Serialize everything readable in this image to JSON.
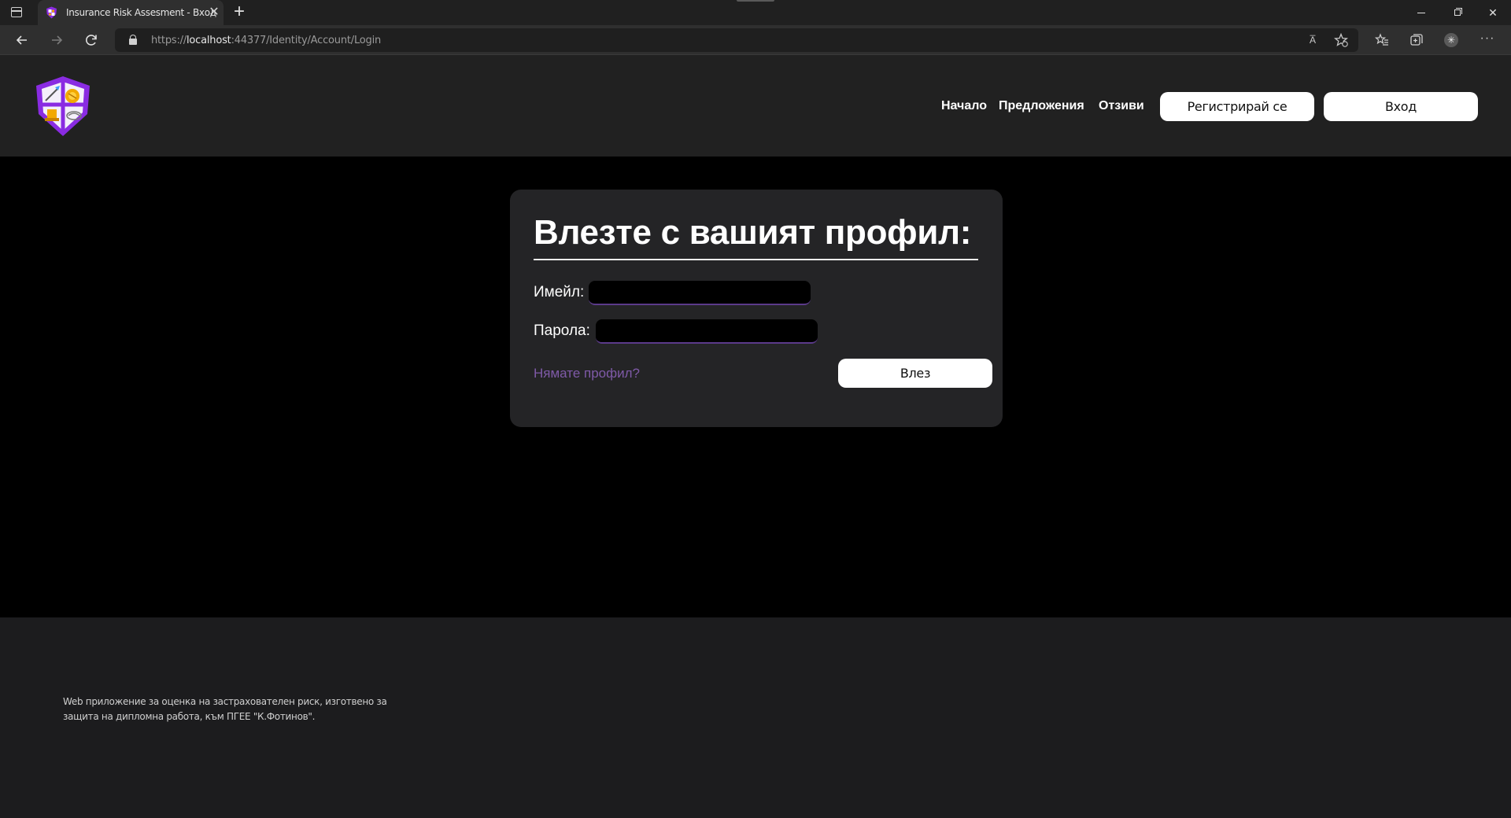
{
  "browser": {
    "tab_title": "Insurance Risk Assesment - Вход",
    "tab_close": "✕",
    "new_tab": "+",
    "url_scheme": "https://",
    "url_host": "localhost",
    "url_rest": ":44377/Identity/Account/Login",
    "read_aloud": "A̅",
    "menu": "···"
  },
  "header": {
    "nav": {
      "home": "Начало",
      "offers": "Предложения",
      "reviews": "Отзиви"
    },
    "register_button": "Регистрирай се",
    "login_button": "Вход"
  },
  "login_card": {
    "title": "Влезте с вашият профил:",
    "email_label": "Имейл:",
    "email_value": "",
    "password_label": "Парола:",
    "password_value": "",
    "no_account_link": "Нямате профил?",
    "submit_button": "Влез"
  },
  "footer": {
    "text": "Web приложение за оценка на застрахователен риск, изготвено за защита на дипломна работа, към ПГЕЕ \"К.Фотинов\"."
  },
  "colors": {
    "header_bg": "#212121",
    "card_bg": "#242426",
    "accent_purple": "#7f5aa8",
    "footer_bg": "#1c1c1e"
  }
}
